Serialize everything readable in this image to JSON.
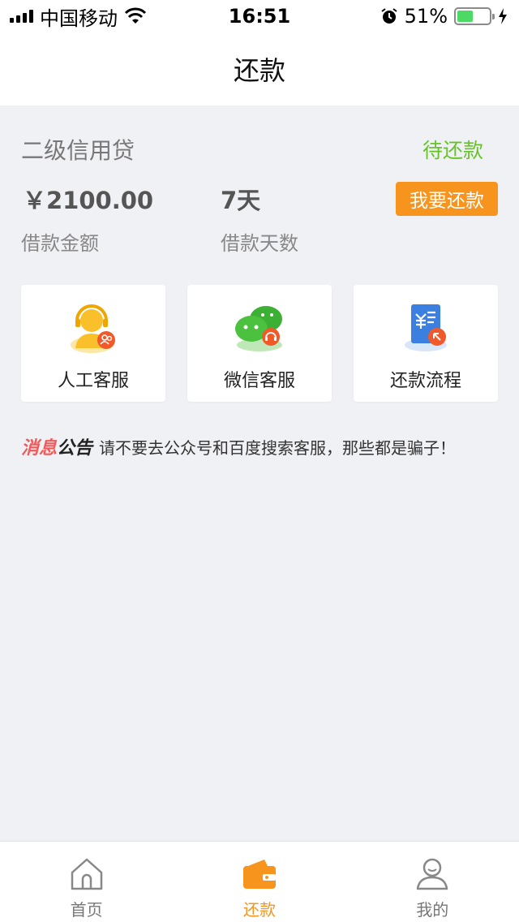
{
  "status_bar": {
    "carrier": "中国移动",
    "time": "16:51",
    "battery": "51%"
  },
  "header": {
    "title": "还款"
  },
  "loan": {
    "name": "二级信用贷",
    "status": "待还款",
    "amount": "￥2100.00",
    "amount_label": "借款金额",
    "days": "7天",
    "days_label": "借款天数",
    "repay_button": "我要还款"
  },
  "services": [
    {
      "label": "人工客服",
      "icon": "agent-icon"
    },
    {
      "label": "微信客服",
      "icon": "wechat-icon"
    },
    {
      "label": "还款流程",
      "icon": "repay-process-icon"
    }
  ],
  "notice": {
    "tag_part1": "消息",
    "tag_part2": "公告",
    "text": "请不要去公众号和百度搜索客服，那些都是骗子！"
  },
  "tabbar": [
    {
      "label": "首页",
      "icon": "home-icon"
    },
    {
      "label": "还款",
      "icon": "wallet-icon"
    },
    {
      "label": "我的",
      "icon": "user-icon"
    }
  ],
  "colors": {
    "accent": "#f7941d",
    "status_green": "#68c32a",
    "notice_red": "#f05a5a"
  }
}
